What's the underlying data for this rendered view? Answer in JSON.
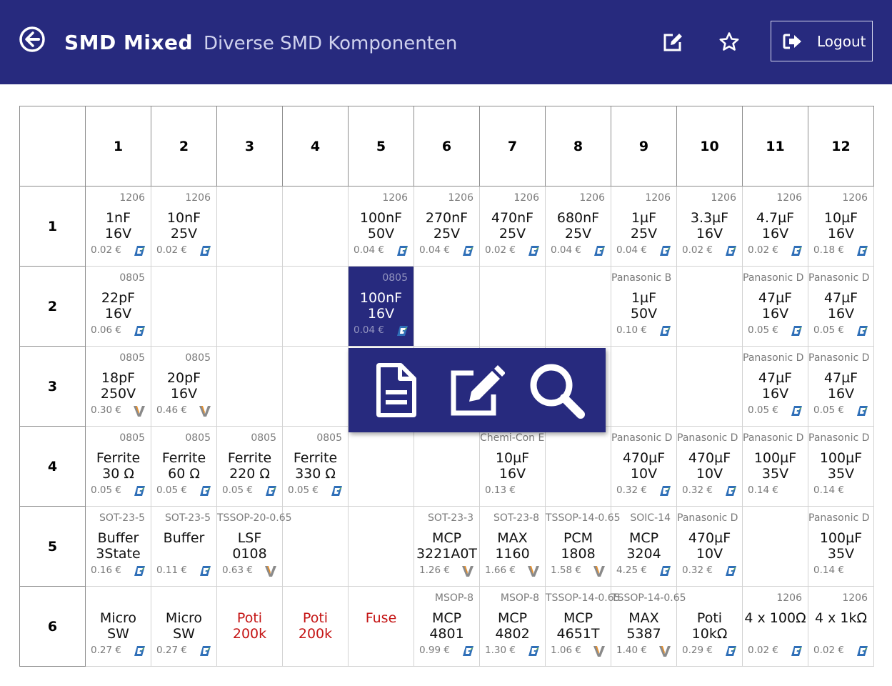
{
  "header": {
    "title": "SMD Mixed",
    "subtitle": "Diverse SMD Komponenten",
    "logout_label": "Logout",
    "icons": {
      "back": "back-arrow-icon",
      "edit": "edit-icon",
      "favorite": "star-icon",
      "logout": "sign-out-icon"
    }
  },
  "colors": {
    "brand": "#272a7e",
    "red_text": "#c41313"
  },
  "grid": {
    "columns": [
      "1",
      "2",
      "3",
      "4",
      "5",
      "6",
      "7",
      "8",
      "9",
      "10",
      "11",
      "12"
    ],
    "rows": [
      {
        "label": "1",
        "cells": [
          {
            "pkg": "1206",
            "l1": "1nF",
            "l2": "16V",
            "price": "0.02 €",
            "logo": "g"
          },
          {
            "pkg": "1206",
            "l1": "10nF",
            "l2": "25V",
            "price": "0.02 €",
            "logo": "g"
          },
          {},
          {},
          {
            "pkg": "1206",
            "l1": "100nF",
            "l2": "50V",
            "price": "0.04 €",
            "logo": "g"
          },
          {
            "pkg": "1206",
            "l1": "270nF",
            "l2": "25V",
            "price": "0.04 €",
            "logo": "g"
          },
          {
            "pkg": "1206",
            "l1": "470nF",
            "l2": "25V",
            "price": "0.02 €",
            "logo": "g"
          },
          {
            "pkg": "1206",
            "l1": "680nF",
            "l2": "25V",
            "price": "0.04 €",
            "logo": "g"
          },
          {
            "pkg": "1206",
            "l1": "1µF",
            "l2": "25V",
            "price": "0.04 €",
            "logo": "g"
          },
          {
            "pkg": "1206",
            "l1": "3.3µF",
            "l2": "16V",
            "price": "0.02 €",
            "logo": "g"
          },
          {
            "pkg": "1206",
            "l1": "4.7µF",
            "l2": "16V",
            "price": "0.02 €",
            "logo": "g"
          },
          {
            "pkg": "1206",
            "l1": "10µF",
            "l2": "16V",
            "price": "0.18 €",
            "logo": "g"
          }
        ]
      },
      {
        "label": "2",
        "cells": [
          {
            "pkg": "0805",
            "l1": "22pF",
            "l2": "16V",
            "price": "0.06 €",
            "logo": "g"
          },
          {},
          {},
          {},
          {
            "pkg": "0805",
            "l1": "100nF",
            "l2": "16V",
            "price": "0.04 €",
            "logo": "g",
            "selected": true
          },
          {},
          {},
          {},
          {
            "pkg": "Panasonic B",
            "l1": "1µF",
            "l2": "50V",
            "price": "0.10 €",
            "logo": "g"
          },
          {},
          {
            "pkg": "Panasonic D",
            "l1": "47µF",
            "l2": "16V",
            "price": "0.05 €",
            "logo": "g"
          },
          {
            "pkg": "Panasonic D",
            "l1": "47µF",
            "l2": "16V",
            "price": "0.05 €",
            "logo": "g"
          }
        ]
      },
      {
        "label": "3",
        "cells": [
          {
            "pkg": "0805",
            "l1": "18pF",
            "l2": "250V",
            "price": "0.30 €",
            "logo": "v"
          },
          {
            "pkg": "0805",
            "l1": "20pF",
            "l2": "16V",
            "price": "0.46 €",
            "logo": "v"
          },
          {},
          {},
          {},
          {},
          {},
          {},
          {},
          {},
          {
            "pkg": "Panasonic D",
            "l1": "47µF",
            "l2": "16V",
            "price": "0.05 €",
            "logo": "g"
          },
          {
            "pkg": "Panasonic D",
            "l1": "47µF",
            "l2": "16V",
            "price": "0.05 €",
            "logo": "g"
          }
        ]
      },
      {
        "label": "4",
        "cells": [
          {
            "pkg": "0805",
            "l1": "Ferrite",
            "l2": "30 Ω",
            "price": "0.05 €",
            "logo": "g"
          },
          {
            "pkg": "0805",
            "l1": "Ferrite",
            "l2": "60 Ω",
            "price": "0.05 €",
            "logo": "g"
          },
          {
            "pkg": "0805",
            "l1": "Ferrite",
            "l2": "220 Ω",
            "price": "0.05 €",
            "logo": "g"
          },
          {
            "pkg": "0805",
            "l1": "Ferrite",
            "l2": "330 Ω",
            "price": "0.05 €",
            "logo": "g"
          },
          {},
          {},
          {
            "pkg": "Chemi-Con E",
            "l1": "10µF",
            "l2": "16V",
            "price": "0.13 €"
          },
          {},
          {
            "pkg": "Panasonic D",
            "l1": "470µF",
            "l2": "10V",
            "price": "0.32 €",
            "logo": "g"
          },
          {
            "pkg": "Panasonic D",
            "l1": "470µF",
            "l2": "10V",
            "price": "0.32 €",
            "logo": "g"
          },
          {
            "pkg": "Panasonic D",
            "l1": "100µF",
            "l2": "35V",
            "price": "0.14 €"
          },
          {
            "pkg": "Panasonic D",
            "l1": "100µF",
            "l2": "35V",
            "price": "0.14 €"
          }
        ]
      },
      {
        "label": "5",
        "cells": [
          {
            "pkg": "SOT-23-5",
            "l1": "Buffer",
            "l2": "3State",
            "price": "0.16 €",
            "logo": "g"
          },
          {
            "pkg": "SOT-23-5",
            "l1": "Buffer",
            "l2": "",
            "price": "0.11 €",
            "logo": "g"
          },
          {
            "pkg": "TSSOP-20-0.65",
            "l1": "LSF",
            "l2": "0108",
            "price": "0.63 €",
            "logo": "v"
          },
          {},
          {},
          {
            "pkg": "SOT-23-3",
            "l1": "MCP",
            "l2": "3221A0T",
            "price": "1.26 €",
            "logo": "v"
          },
          {
            "pkg": "SOT-23-8",
            "l1": "MAX",
            "l2": "1160",
            "price": "1.66 €",
            "logo": "v"
          },
          {
            "pkg": "TSSOP-14-0.65",
            "l1": "PCM",
            "l2": "1808",
            "price": "1.58 €",
            "logo": "v"
          },
          {
            "pkg": "SOIC-14",
            "l1": "MCP",
            "l2": "3204",
            "price": "4.25 €",
            "logo": "g"
          },
          {
            "pkg": "Panasonic D",
            "l1": "470µF",
            "l2": "10V",
            "price": "0.32 €",
            "logo": "g"
          },
          {},
          {
            "pkg": "Panasonic D",
            "l1": "100µF",
            "l2": "35V",
            "price": "0.14 €"
          }
        ]
      },
      {
        "label": "6",
        "cells": [
          {
            "pkg": "",
            "l1": "Micro",
            "l2": "SW",
            "price": "0.27 €",
            "logo": "g"
          },
          {
            "pkg": "",
            "l1": "Micro",
            "l2": "SW",
            "price": "0.27 €",
            "logo": "g"
          },
          {
            "pkg": "",
            "l1": "Poti",
            "l2": "200k",
            "red": true
          },
          {
            "pkg": "",
            "l1": "Poti",
            "l2": "200k",
            "red": true
          },
          {
            "pkg": "",
            "l1": "Fuse",
            "l2": "",
            "red": true
          },
          {
            "pkg": "MSOP-8",
            "l1": "MCP",
            "l2": "4801",
            "price": "0.99 €",
            "logo": "g"
          },
          {
            "pkg": "MSOP-8",
            "l1": "MCP",
            "l2": "4802",
            "price": "1.30 €",
            "logo": "g"
          },
          {
            "pkg": "TSSOP-14-0.65",
            "l1": "MCP",
            "l2": "4651T",
            "price": "1.06 €",
            "logo": "v"
          },
          {
            "pkg": "TSSOP-14-0.65",
            "l1": "MAX",
            "l2": "5387",
            "price": "1.40 €",
            "logo": "v"
          },
          {
            "pkg": "",
            "l1": "Poti",
            "l2": "10kΩ",
            "price": "0.29 €",
            "logo": "g"
          },
          {
            "pkg": "1206",
            "l1": "4 x 100Ω",
            "l2": "",
            "price": "0.02 €",
            "logo": "g"
          },
          {
            "pkg": "1206",
            "l1": "4 x 1kΩ",
            "l2": "",
            "price": "0.02 €",
            "logo": "g"
          }
        ]
      }
    ]
  },
  "popup": {
    "icons": [
      "document-icon",
      "edit-icon",
      "search-icon"
    ]
  }
}
